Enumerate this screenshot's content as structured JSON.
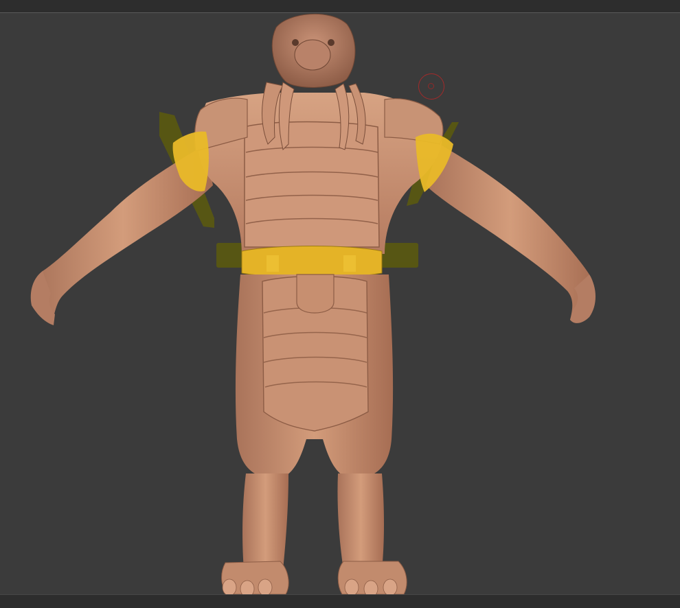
{
  "app": {
    "window": "zbrush-canvas-viewport"
  },
  "canvas": {
    "background": "#3b3b3b",
    "model_color": "#c48c6c",
    "mask_color": "#f2c12b",
    "gizmo_color": "#5b5a0f"
  },
  "tool": {
    "cursor": "draw-size-brush-cursor"
  },
  "icons": {
    "brush": "circle-brush-icon"
  }
}
